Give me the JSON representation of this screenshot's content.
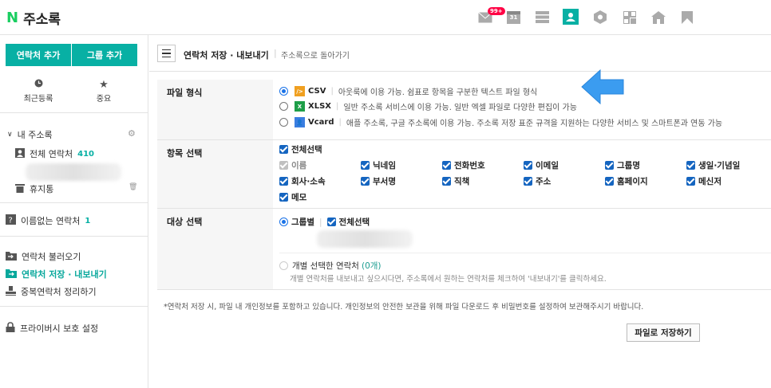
{
  "header": {
    "logo_letter": "N",
    "title": "주소록",
    "mail_badge": "99+",
    "calendar_day": "31"
  },
  "sidebar": {
    "add_contact": "연락처 추가",
    "add_group": "그룹 추가",
    "recent": "최근등록",
    "important": "중요",
    "my_addressbook": "내 주소록",
    "all_contacts": "전체 연락처",
    "all_count": "410",
    "trash": "휴지통",
    "unnamed": "이름없는 연락처",
    "unnamed_count": "1",
    "import": "연락처 불러오기",
    "export": "연락처 저장 · 내보내기",
    "dedupe": "중복연락처 정리하기",
    "privacy": "프라이버시 보호 설정"
  },
  "main": {
    "crumb": "연락처 저장 · 내보내기",
    "crumb_sep": "|",
    "back": "주소록으로 돌아가기",
    "format_label": "파일 형식",
    "formats": [
      {
        "name": "CSV",
        "desc": "아웃룩에 이용 가능. 쉼표로 항목을 구분한 텍스트 파일 형식",
        "selected": true
      },
      {
        "name": "XLSX",
        "desc": "일반 주소록 서비스에 이용 가능. 일반 엑셀 파일로 다양한 편집이 가능",
        "selected": false
      },
      {
        "name": "Vcard",
        "desc": "애플 주소록, 구글 주소록에 이용 가능. 주소록 저장 표준 규격을 지원하는 다양한 서비스 및 스마트폰과 연동 가능",
        "selected": false
      }
    ],
    "fields_label": "항목 선택",
    "select_all": "전체선택",
    "fields": [
      "이름",
      "닉네임",
      "전화번호",
      "이메일",
      "그룹명",
      "생일·기념일",
      "회사·소속",
      "부서명",
      "직책",
      "주소",
      "홈페이지",
      "메신저",
      "메모"
    ],
    "target_label": "대상 선택",
    "by_group": "그룹별",
    "group_select_all": "전체선택",
    "individual": "개별 선택한 연락처",
    "individual_count": "(0개)",
    "individual_hint": "개별 연락처를 내보내고 싶으시다면, 주소록에서 원하는 연락처를 체크하여 '내보내기'를 클릭하세요.",
    "notice": "*연락처 저장 시, 파일 내 개인정보를 포함하고 있습니다. 개인정보의 안전한 보관을 위해 파일 다운로드 후 비밀번호를 설정하여 보관해주시기 바랍니다.",
    "save_button": "파일로 저장하기"
  },
  "colors": {
    "accent": "#08b0a4",
    "brand_green": "#19ce60",
    "check_blue": "#1565c0",
    "arrow": "#3b9cf0"
  }
}
